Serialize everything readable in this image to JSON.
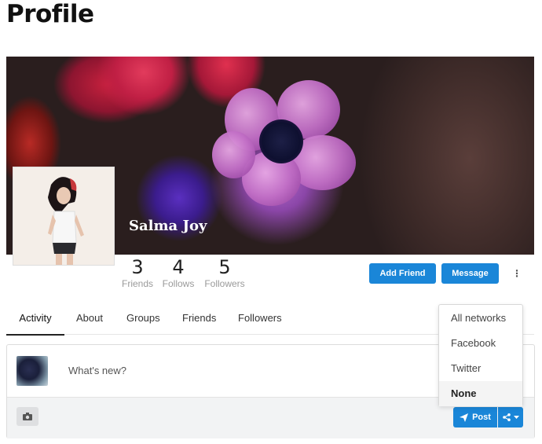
{
  "page": {
    "title": "Profile"
  },
  "profile": {
    "name": "Salma Joy",
    "stats": [
      {
        "value": "3",
        "label": "Friends"
      },
      {
        "value": "4",
        "label": "Follows"
      },
      {
        "value": "5",
        "label": "Followers"
      }
    ],
    "actions": {
      "add_friend": "Add Friend",
      "message": "Message",
      "more": "⋮"
    }
  },
  "tabs": [
    {
      "label": "Activity",
      "active": true
    },
    {
      "label": "About",
      "active": false
    },
    {
      "label": "Groups",
      "active": false
    },
    {
      "label": "Friends",
      "active": false
    },
    {
      "label": "Followers",
      "active": false
    }
  ],
  "composer": {
    "placeholder": "What's new?",
    "post_label": "Post"
  },
  "share_menu": {
    "items": [
      "All networks",
      "Facebook",
      "Twitter",
      "None"
    ],
    "selected": "None"
  },
  "colors": {
    "accent": "#1a86d8"
  },
  "icons": [
    "camera-icon",
    "send-icon",
    "share-icon",
    "caret-down-icon",
    "more-vertical-icon"
  ]
}
